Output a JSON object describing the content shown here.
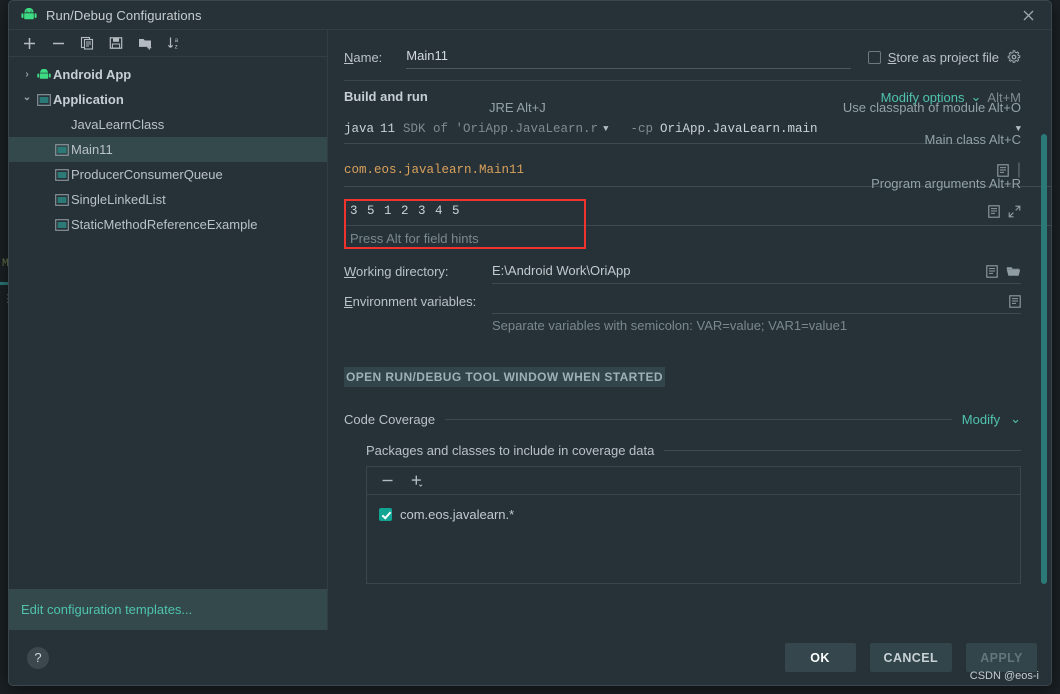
{
  "window": {
    "title": "Run/Debug Configurations",
    "app_icon": "android-icon",
    "close_icon": "close-icon"
  },
  "left_toolbar": {
    "items": [
      {
        "icon": "plus-icon",
        "label": "Add New Configuration"
      },
      {
        "icon": "minus-icon",
        "label": "Remove Configuration"
      },
      {
        "icon": "copy-icon",
        "label": "Copy Configuration"
      },
      {
        "icon": "save-icon",
        "label": "Save Configuration"
      },
      {
        "icon": "folder-add-icon",
        "label": "Move into New Folder"
      },
      {
        "icon": "sort-az-icon",
        "label": "Sort Configurations"
      }
    ]
  },
  "tree": {
    "nodes": [
      {
        "label": "Android App",
        "icon": "android-icon",
        "twisty": "›",
        "type": "group",
        "selected": false
      },
      {
        "label": "Application",
        "icon": "application-icon",
        "twisty": "⌄",
        "type": "group",
        "selected": false
      },
      {
        "label": "JavaLearnClass",
        "icon": "",
        "twisty": "",
        "type": "child-noicon",
        "selected": false
      },
      {
        "label": "Main11",
        "icon": "application-icon",
        "twisty": "",
        "type": "child",
        "selected": true
      },
      {
        "label": "ProducerConsumerQueue",
        "icon": "application-icon",
        "twisty": "",
        "type": "child",
        "selected": false
      },
      {
        "label": "SingleLinkedList",
        "icon": "application-icon",
        "twisty": "",
        "type": "child",
        "selected": false
      },
      {
        "label": "StaticMethodReferenceExample",
        "icon": "application-icon",
        "twisty": "",
        "type": "child",
        "selected": false
      }
    ],
    "edit_templates": "Edit configuration templates..."
  },
  "form": {
    "name_label": "Name:",
    "name_value": "Main11",
    "store_as_project_file": "Store as project file",
    "store_checked": false,
    "gear_icon": "gear-icon",
    "build_and_run": "Build and run",
    "modify_options": "Modify options",
    "modify_options_mnemonic": "Alt+M",
    "hint_jre": "JRE Alt+J",
    "hint_classpath": "Use classpath of module Alt+O",
    "hint_main_class": "Main class Alt+C",
    "hint_program_args": "Program arguments Alt+R",
    "jre_java": "java",
    "jre_version": "11",
    "jre_sdk_of": "SDK of 'OriApp.JavaLearn.r",
    "cp_flag": "-cp",
    "cp_value": "OriApp.JavaLearn.main",
    "main_class_value": "com.eos.javalearn.Main11",
    "program_arguments_value": "3 5 1 2 3 4 5",
    "program_arguments_hint": "Press Alt for field hints",
    "working_directory_label": "Working directory:",
    "working_directory_value": "E:\\Android Work\\OriApp",
    "environment_variables_label": "Environment variables:",
    "environment_variables_value": "",
    "environment_variables_helper": "Separate variables with semicolon: VAR=value; VAR1=value1",
    "tool_window_banner": "OPEN RUN/DEBUG TOOL WINDOW WHEN STARTED",
    "highlight_color": "#f0332f",
    "accent_color": "#4fc3ae"
  },
  "coverage": {
    "section_title": "Code Coverage",
    "modify_link": "Modify",
    "packages_caption": "Packages and classes to include in coverage data",
    "toolbar": [
      {
        "icon": "minus-icon",
        "label": "Remove Pattern"
      },
      {
        "icon": "plus-icon",
        "label": "Add Pattern"
      }
    ],
    "items": [
      {
        "label": "com.eos.javalearn.*",
        "checked": true
      }
    ]
  },
  "footer": {
    "help_label": "?",
    "ok_label": "OK",
    "cancel_label": "CANCEL",
    "apply_label": "APPLY",
    "apply_enabled": false,
    "watermark": "CSDN @eos-i"
  },
  "backdrop": {
    "fragments": [
      "M",
      "⋮"
    ]
  }
}
